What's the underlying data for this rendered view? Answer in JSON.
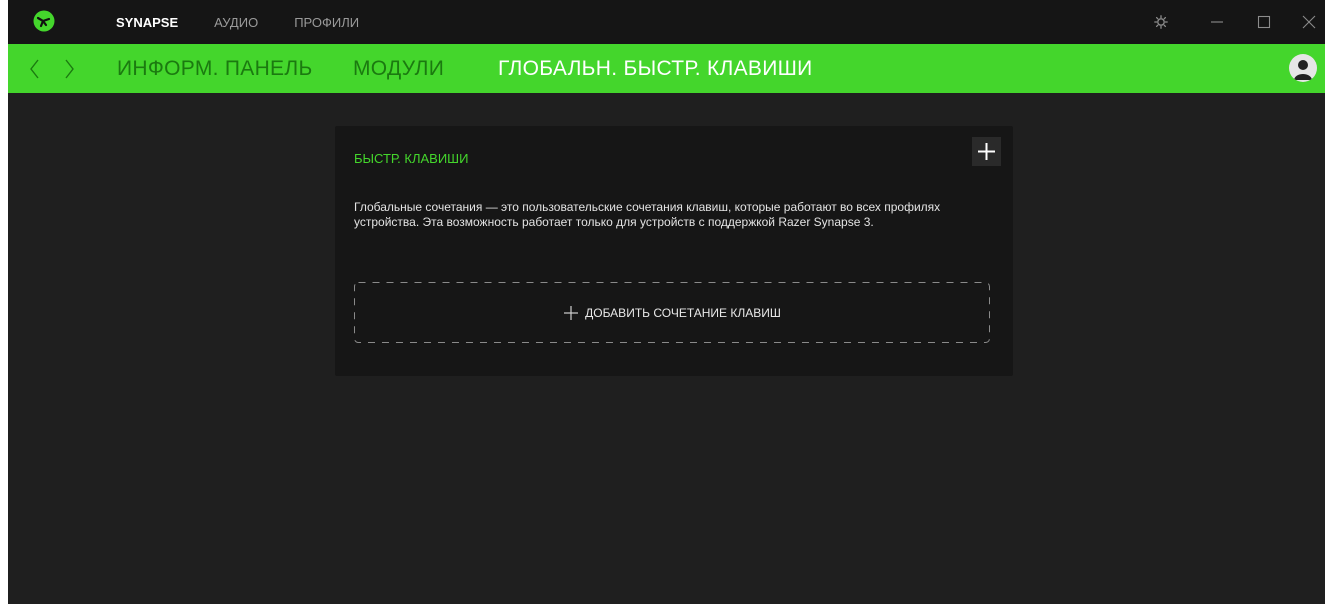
{
  "app": {
    "top_nav": [
      {
        "label": "SYNAPSE",
        "active": true
      },
      {
        "label": "АУДИО",
        "active": false
      },
      {
        "label": "ПРОФИЛИ",
        "active": false
      }
    ],
    "window_controls": [
      "gear-icon",
      "minimize-icon",
      "maximize-icon",
      "close-icon"
    ]
  },
  "sub_nav": {
    "tabs": [
      {
        "label": "ИНФОРМ. ПАНЕЛЬ",
        "active": false
      },
      {
        "label": "МОДУЛИ",
        "active": false
      },
      {
        "label": "ГЛОБАЛЬН. БЫСТР. КЛАВИШИ",
        "active": true
      }
    ]
  },
  "card": {
    "title": "БЫСТР. КЛАВИШИ",
    "description": "Глобальные сочетания — это пользовательские сочетания клавиш, которые работают во всех профилях устройства. Эта возможность работает только для устройств с поддержкой Razer Synapse 3.",
    "add_label": "ДОБАВИТЬ СОЧЕТАНИЕ КЛАВИШ"
  },
  "colors": {
    "accent": "#44d62c",
    "background": "#1f1f1f",
    "card": "#161616",
    "titlebar": "#151515"
  }
}
